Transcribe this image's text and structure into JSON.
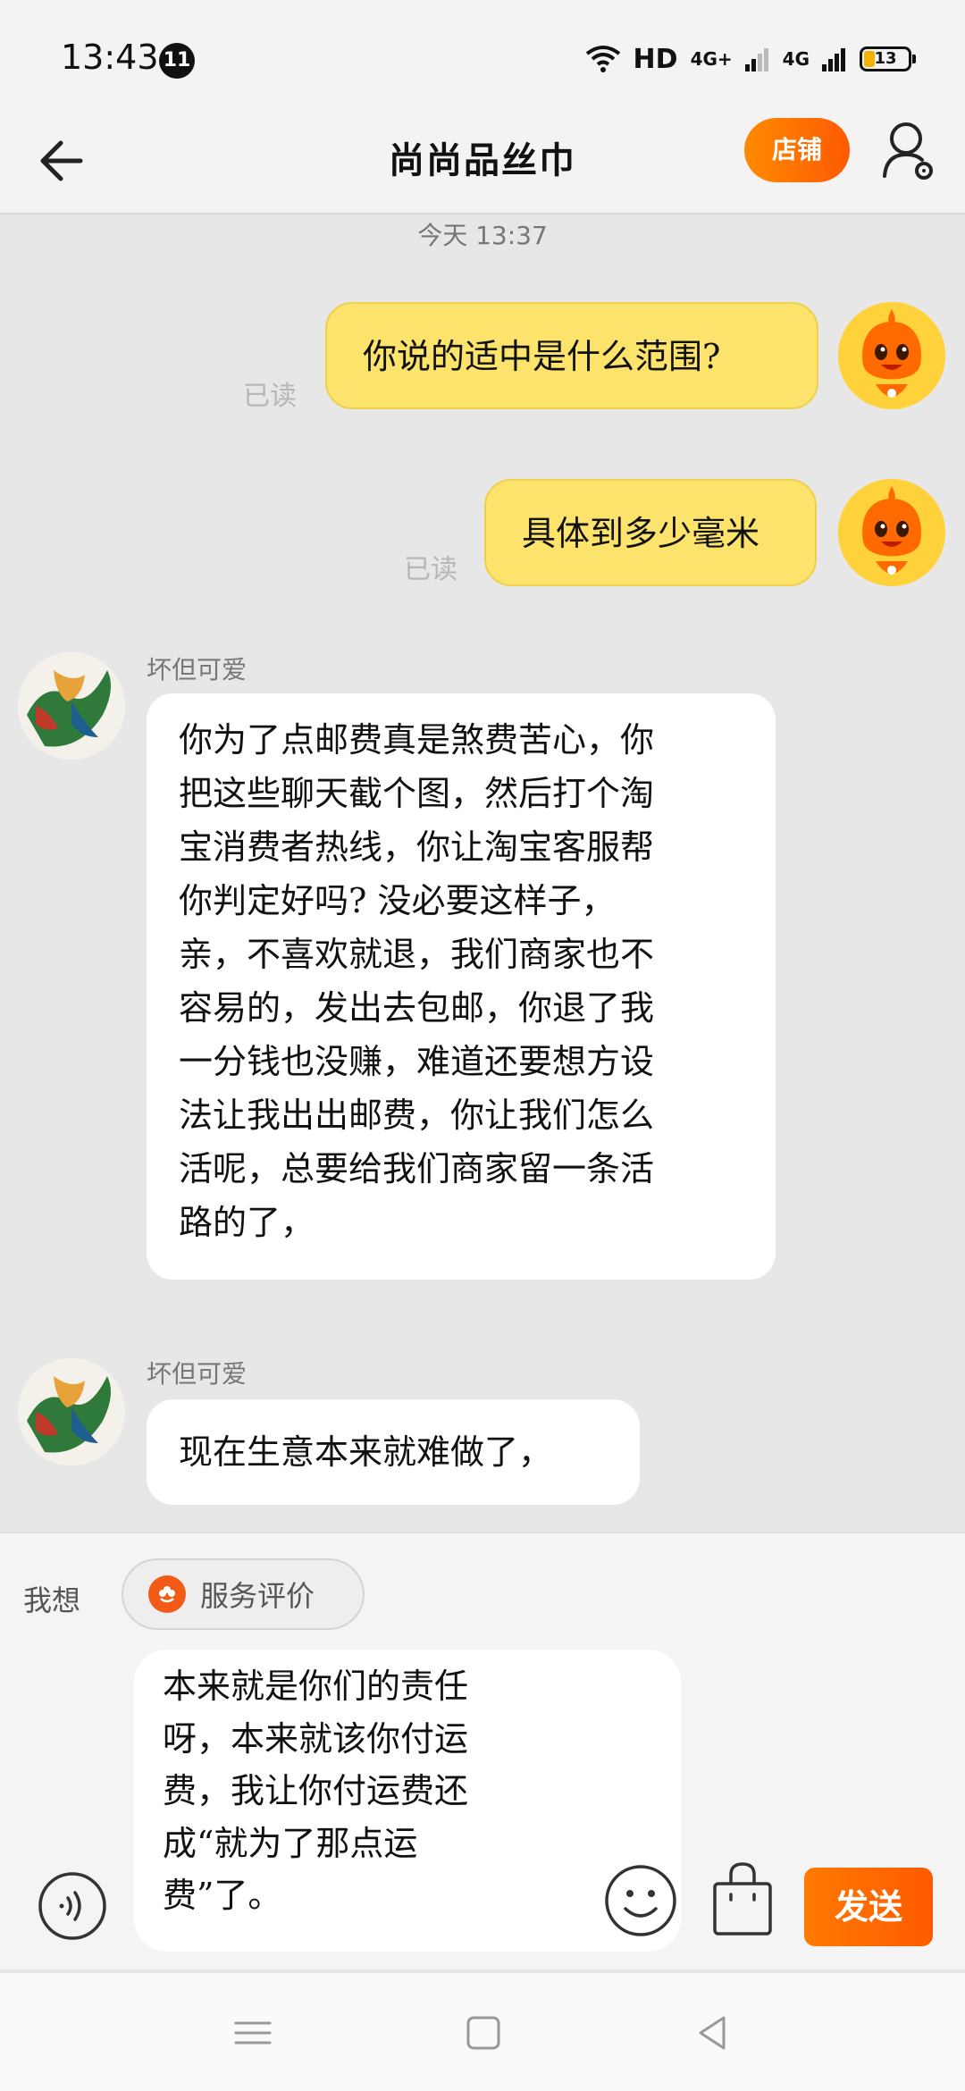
{
  "status_bar": {
    "time": "13:43",
    "notification_count": "11",
    "hd_label": "HD",
    "network1": "4G+",
    "network2": "4G",
    "battery": "13"
  },
  "nav": {
    "title": "尚尚品丝巾",
    "shop_label": "店铺"
  },
  "chat": {
    "timestamp": "今天  13:37",
    "messages": [
      {
        "direction": "out",
        "text": "你说的适中是什么范围?",
        "status": "已读"
      },
      {
        "direction": "out",
        "text": "具体到多少毫米",
        "status": "已读"
      },
      {
        "direction": "in",
        "sender": "坏但可爱",
        "lines": [
          "你为了点邮费真是煞费苦心，你",
          "把这些聊天截个图，然后打个淘",
          "宝消费者热线，你让淘宝客服帮",
          "你判定好吗? 没必要这样子，",
          "亲，不喜欢就退，我们商家也不",
          "容易的，发出去包邮，你退了我",
          "一分钱也没赚，难道还要想方设",
          "法让我出出邮费，你让我们怎么",
          "活呢，总要给我们商家留一条活",
          "路的了，"
        ]
      },
      {
        "direction": "in",
        "sender": "坏但可爱",
        "text": "现在生意本来就难做了，"
      }
    ]
  },
  "input": {
    "quick_label": "我想",
    "quick_chip": "服务评价",
    "draft_lines": [
      "本来就是你们的责任",
      "呀，本来就该你付运",
      "费，我让你付运费还",
      "成“就为了那点运",
      "费”了。"
    ],
    "send_label": "发送"
  },
  "icons": {
    "back": "arrow-left-icon",
    "profile": "user-settings-icon",
    "voice": "voice-icon",
    "emoji": "emoji-icon",
    "bag": "shopping-bag-icon",
    "chip": "flower-icon"
  },
  "colors": {
    "accent": "#ff6a00",
    "out_bubble": "#fce36b",
    "in_bubble": "#ffffff",
    "background": "#e7e7e7"
  }
}
